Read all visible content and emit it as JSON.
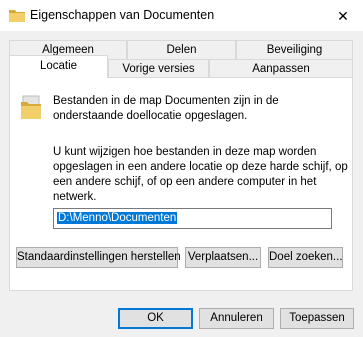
{
  "window": {
    "title": "Eigenschappen van Documenten",
    "close_glyph": "✕"
  },
  "tabs": [
    {
      "label": "Algemeen"
    },
    {
      "label": "Delen"
    },
    {
      "label": "Beveiliging"
    },
    {
      "label": "Locatie",
      "active": true
    },
    {
      "label": "Vorige versies"
    },
    {
      "label": "Aanpassen"
    }
  ],
  "content": {
    "icon": "folder-icon",
    "description": "Bestanden in de map Documenten zijn in de onderstaande doellocatie opgeslagen.",
    "info": "U kunt wijzigen hoe bestanden in deze map worden opgeslagen in een andere locatie op deze harde schijf, op een andere schijf, of op een andere computer in het netwerk.",
    "path_value": "D:\\Menno\\Documenten"
  },
  "actions": {
    "restore_default": "Standaardinstellingen herstellen",
    "move": "Verplaatsen...",
    "find_target": "Doel zoeken..."
  },
  "footer": {
    "ok": "OK",
    "cancel": "Annuleren",
    "apply": "Toepassen"
  },
  "colors": {
    "selection": "#0078d7",
    "folder": "#e8c05a"
  }
}
